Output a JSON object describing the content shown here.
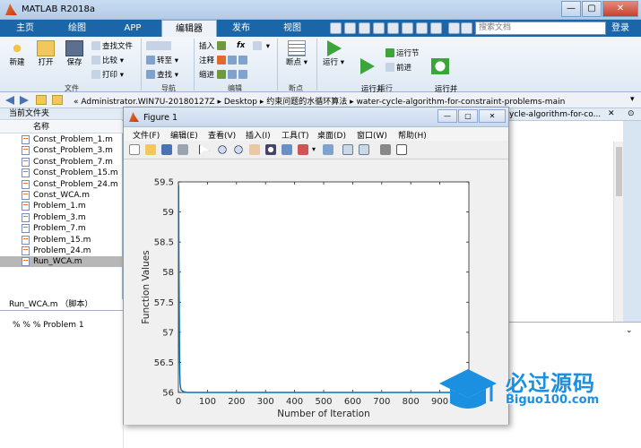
{
  "window": {
    "title": "MATLAB R2018a"
  },
  "tabs": [
    {
      "label": "主页"
    },
    {
      "label": "绘图"
    },
    {
      "label": "APP"
    },
    {
      "label": "编辑器"
    },
    {
      "label": "发布"
    },
    {
      "label": "视图"
    }
  ],
  "search_placeholder": "搜索文档",
  "login_label": "登录",
  "ribbon": {
    "file": {
      "new": "新建",
      "open": "打开",
      "save": "保存",
      "find_files": "查找文件",
      "compare": "比较",
      "print": "打印",
      "group": "文件"
    },
    "navigate": {
      "goto": "转至",
      "find": "查找",
      "group": "导航"
    },
    "edit": {
      "insert": "插入",
      "comment": "注释",
      "indent": "缩进",
      "fx": "fx",
      "group": "编辑"
    },
    "breakpoints": {
      "label": "断点",
      "group": "断点"
    },
    "run": {
      "run": "运行",
      "run_advance": "运行并\n前进",
      "run_section": "运行节",
      "advance": "前进",
      "run_time": "运行并\n计时",
      "group": "运行"
    }
  },
  "address": {
    "path": [
      "«",
      "Administrator.WIN7U-20180127Z",
      "Desktop",
      "约束问题的水循环算法",
      "water-cycle-algorithm-for-constraint-problems-main"
    ]
  },
  "current_folder": {
    "title": "当前文件夹",
    "column": "名称",
    "files": [
      "Const_Problem_1.m",
      "Const_Problem_3.m",
      "Const_Problem_7.m",
      "Const_Problem_15.m",
      "Const_Problem_24.m",
      "Const_WCA.m",
      "Problem_1.m",
      "Problem_3.m",
      "Problem_7.m",
      "Problem_15.m",
      "Problem_24.m",
      "Run_WCA.m"
    ],
    "selected": "Run_WCA.m",
    "details_header": "Run_WCA.m （脚本）",
    "details_text": "% % %  Problem 1"
  },
  "editor_tab_text": "ycle-algorithm-for-co...",
  "figure": {
    "title": "Figure 1",
    "menu": [
      "文件(F)",
      "编辑(E)",
      "查看(V)",
      "插入(I)",
      "工具(T)",
      "桌面(D)",
      "窗口(W)",
      "帮助(H)"
    ],
    "buttons": {
      "minimize": "—",
      "restore": "▢",
      "close": "✕"
    }
  },
  "chart_data": {
    "type": "line",
    "title": "",
    "xlabel": "Number of Iteration",
    "ylabel": "Function Values",
    "xlim": [
      0,
      1000
    ],
    "ylim": [
      56,
      59.5
    ],
    "xticks": [
      0,
      100,
      200,
      300,
      400,
      500,
      600,
      700,
      800,
      900,
      1000
    ],
    "yticks": [
      56,
      56.5,
      57,
      57.5,
      58,
      58.5,
      59,
      59.5
    ],
    "ytick_labels": [
      "56",
      "56.5",
      "57",
      "57.5",
      "58",
      "58.5",
      "59",
      "59.5"
    ],
    "series": [
      {
        "x": [
          1,
          2,
          3,
          4,
          5,
          6,
          8,
          10,
          15,
          20,
          30,
          1000
        ],
        "y": [
          59.45,
          58.2,
          57.3,
          56.6,
          56.3,
          56.15,
          56.07,
          56.04,
          56.02,
          56.01,
          56.0,
          56.0
        ],
        "color": "#0072bd"
      }
    ],
    "grid": false
  },
  "watermark": {
    "title": "必过源码",
    "sub": "Biguo100.com",
    "color": "#1b8fe0"
  }
}
